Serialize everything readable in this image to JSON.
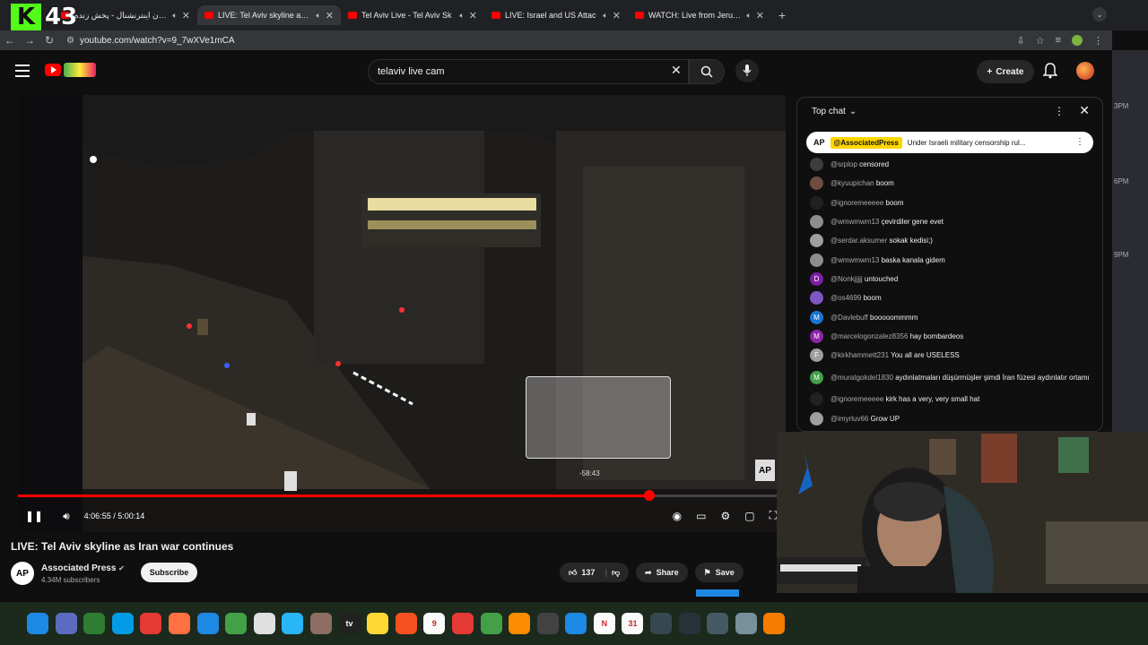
{
  "stream_overlay": {
    "viewer_count": "43"
  },
  "browser": {
    "tabs": [
      {
        "label": "ایران اینترنشنال - پخش زنده",
        "active": false
      },
      {
        "label": "LIVE: Tel Aviv skyline as Ir",
        "active": true
      },
      {
        "label": "Tel Aviv Live - Tel Aviv Sk",
        "active": false
      },
      {
        "label": "LIVE: Israel and US Attac",
        "active": false
      },
      {
        "label": "WATCH: Live from Jerusal",
        "active": false
      }
    ],
    "url": "youtube.com/watch?v=9_7wXVe1mCA"
  },
  "desktop_times": [
    "3PM",
    "6PM",
    "9PM"
  ],
  "youtube": {
    "search_value": "telaviv live cam",
    "create_label": "Create",
    "video": {
      "title": "LIVE: Tel Aviv skyline as Iran war continues",
      "time_display": "4:06:55 / 5:00:14",
      "progress_fraction": 0.823,
      "preview_time": "-58:43",
      "watermark": "AP"
    },
    "channel": {
      "name": "Associated Press",
      "avatar_text": "AP",
      "subscribers": "4.34M subscribers",
      "subscribe_label": "Subscribe"
    },
    "actions": {
      "likes": "137",
      "share": "Share",
      "save": "Save"
    },
    "chat": {
      "header": "Top chat",
      "pinned": {
        "avatar": "AP",
        "author": "@AssociatedPress",
        "text": "Under Israeli military censorship rul..."
      },
      "messages": [
        {
          "author": "@srplop",
          "text": "censored",
          "color": "#3c3c3c",
          "initial": ""
        },
        {
          "author": "@kyuupichan",
          "text": "boom",
          "color": "#6d4c41",
          "initial": ""
        },
        {
          "author": "@ignoremeeeee",
          "text": "boom",
          "color": "#212121",
          "initial": ""
        },
        {
          "author": "@wmwmwm13",
          "text": "çevirdiler gene evet",
          "color": "#8d8d8d",
          "initial": ""
        },
        {
          "author": "@serdar.aksumer",
          "text": "sokak kedisi;)",
          "color": "#9e9e9e",
          "initial": ""
        },
        {
          "author": "@wmwmwm13",
          "text": "baska kanala gidem",
          "color": "#8d8d8d",
          "initial": ""
        },
        {
          "author": "@Nonkjjjjj",
          "text": "untouched",
          "color": "#7b1fa2",
          "initial": "D"
        },
        {
          "author": "@os4699",
          "text": "boom",
          "color": "#7e57c2",
          "initial": ""
        },
        {
          "author": "@Davlebuff",
          "text": "booooommmm",
          "color": "#1976d2",
          "initial": "M"
        },
        {
          "author": "@marcelogonzalez8356",
          "text": "hay bombardeos",
          "color": "#8e24aa",
          "initial": "M"
        },
        {
          "author": "@kirkhammett231",
          "text": "You all are USELESS",
          "color": "#9e9e9e",
          "initial": "F"
        },
        {
          "author": "@muratgokdel1830",
          "text": "aydınlatmaları düşürmüşler şimdi İran füzesi aydınlatır ortamı",
          "color": "#43a047",
          "initial": "M"
        },
        {
          "author": "@ignoremeeeee",
          "text": "kirk has a very, very small hat",
          "color": "#212121",
          "initial": ""
        },
        {
          "author": "@imyrluv66",
          "text": "Grow UP",
          "color": "#9e9e9e",
          "initial": ""
        }
      ]
    }
  },
  "dock": {
    "apps": [
      {
        "icon": "finder-icon",
        "color": "#1e88e5",
        "text": ""
      },
      {
        "icon": "launchpad-icon",
        "color": "#5c6bc0",
        "text": ""
      },
      {
        "icon": "terminal-icon",
        "color": "#2e7d32",
        "text": ""
      },
      {
        "icon": "safari-icon",
        "color": "#039be5",
        "text": ""
      },
      {
        "icon": "chrome-icon",
        "color": "#e53935",
        "text": ""
      },
      {
        "icon": "photos-icon",
        "color": "#ff7043",
        "text": ""
      },
      {
        "icon": "mail-icon",
        "color": "#1e88e5",
        "text": ""
      },
      {
        "icon": "facetime-icon",
        "color": "#43a047",
        "text": ""
      },
      {
        "icon": "calendar-badge-icon",
        "color": "#e0e0e0",
        "text": ""
      },
      {
        "icon": "freeform-icon",
        "color": "#29b6f6",
        "text": ""
      },
      {
        "icon": "archive-icon",
        "color": "#8d6e63",
        "text": ""
      },
      {
        "icon": "appletv-icon",
        "color": "#212121",
        "text": "tv"
      },
      {
        "icon": "notes-icon",
        "color": "#fdd835",
        "text": ""
      },
      {
        "icon": "music-icon",
        "color": "#f4511e",
        "text": ""
      },
      {
        "icon": "calendar-icon",
        "color": "#fafafa",
        "text": "9"
      },
      {
        "icon": "news-icon",
        "color": "#e53935",
        "text": ""
      },
      {
        "icon": "numbers-icon",
        "color": "#43a047",
        "text": ""
      },
      {
        "icon": "pages-icon",
        "color": "#fb8c00",
        "text": ""
      },
      {
        "icon": "chatgpt-icon",
        "color": "#424242",
        "text": ""
      },
      {
        "icon": "appstore-icon",
        "color": "#1e88e5",
        "text": ""
      },
      {
        "icon": "notion-icon",
        "color": "#fafafa",
        "text": "N"
      },
      {
        "icon": "calendar2-icon",
        "color": "#fafafa",
        "text": "31"
      },
      {
        "icon": "globe-icon",
        "color": "#37474f",
        "text": ""
      },
      {
        "icon": "audio-icon",
        "color": "#263238",
        "text": ""
      },
      {
        "icon": "hexagon-icon",
        "color": "#455a64",
        "text": ""
      },
      {
        "icon": "settings-icon",
        "color": "#78909c",
        "text": ""
      },
      {
        "icon": "vpn-icon",
        "color": "#f57c00",
        "text": ""
      }
    ]
  }
}
